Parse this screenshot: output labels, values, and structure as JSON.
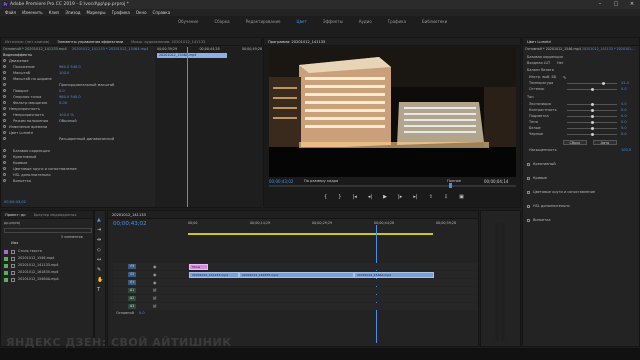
{
  "app": {
    "title": "Adobe Premiere Pro CC 2019 - E:\\vocd\\pp\\pp.prproj *",
    "icon": "Pr"
  },
  "menu": [
    "Файл",
    "Изменить",
    "Клип",
    "Эпизод",
    "Маркеры",
    "Графика",
    "Окно",
    "Справка"
  ],
  "workspaces": [
    {
      "label": "Обучение",
      "active": false
    },
    {
      "label": "Сборка",
      "active": false
    },
    {
      "label": "Редактирование",
      "active": false
    },
    {
      "label": "Цвет",
      "active": true
    },
    {
      "label": "Эффекты",
      "active": false
    },
    {
      "label": "Аудио",
      "active": false
    },
    {
      "label": "Графика",
      "active": false
    },
    {
      "label": "Библиотеки",
      "active": false
    }
  ],
  "source_panel": {
    "tabs": [
      "Источник: (нет клипов)",
      "Элементы управления эффектами",
      "Микш. аудиоклипов: 20201012_141133"
    ],
    "header": "Основной * 20201012_141133.mp4",
    "header2": "20201012_141133 * 20201012_15464.mp4",
    "video_effects_label": "Видеоэффекты",
    "rows": [
      {
        "label": "Движение",
        "value": ""
      },
      {
        "label": "Положение",
        "value": "960.0   540.0"
      },
      {
        "label": "Масштаб",
        "value": "100.0"
      },
      {
        "label": "Масштаб по ширине",
        "value": ""
      },
      {
        "label": "",
        "value": "Пропорциональный масштаб"
      },
      {
        "label": "Поворот",
        "value": "0.0"
      },
      {
        "label": "Опорная точка",
        "value": "960.0   540.0"
      },
      {
        "label": "Фильтр мерцания",
        "value": "0.00"
      },
      {
        "label": "Непрозрачность",
        "value": ""
      },
      {
        "label": "Непрозрачность",
        "value": "100.0 %"
      },
      {
        "label": "Режим наложения",
        "value": "Обычный"
      },
      {
        "label": "Изменение времени",
        "value": ""
      },
      {
        "label": "Цвет Lumetri",
        "value": ""
      },
      {
        "label": "",
        "value": "Расширенный динамический"
      },
      {
        "label": "Базовая коррекция",
        "value": ""
      },
      {
        "label": "Креативный",
        "value": ""
      },
      {
        "label": "Кривые",
        "value": ""
      },
      {
        "label": "Цветовые круги и сопоставление",
        "value": ""
      },
      {
        "label": "HSL дополнительно",
        "value": ""
      },
      {
        "label": "Виньетка",
        "value": ""
      }
    ],
    "mini_tl": {
      "times": [
        "00;00;39;29",
        "00;00;44;28",
        "00;00;49;28"
      ],
      "clip": "20201012_1546A.mp4",
      "timecode": "00;00;43;02"
    }
  },
  "program": {
    "title": "Программа: 20201012_141133",
    "timecode_left": "00;00;43;02",
    "fit": "По размеру кадра",
    "quality": "Полное",
    "timecode_right": "00;00;04;14"
  },
  "lumetri": {
    "tabs": [
      "Цвет Lumetri"
    ],
    "header": "Основной * 20201012_1546.mp4",
    "header2": "20201012_141133 * 2020101...",
    "sections": [
      {
        "label": "Базовая коррекция"
      },
      {
        "label": "Входная LUT",
        "value": "Нет"
      },
      {
        "label": "Баланс белого"
      }
    ],
    "wb_rows": [
      {
        "label": "Инстр. выб. ББ",
        "value": ""
      },
      {
        "label": "Температура",
        "value": "41.4",
        "pct": 0.72
      },
      {
        "label": "Оттенок",
        "value": "0.0",
        "pct": 0.5
      }
    ],
    "tone_label": "Тон",
    "tone_rows": [
      {
        "label": "Экспозиция",
        "value": "0.0",
        "pct": 0.5
      },
      {
        "label": "Контрастность",
        "value": "0.0",
        "pct": 0.5
      },
      {
        "label": "Подсветка",
        "value": "0.0",
        "pct": 0.5
      },
      {
        "label": "Тени",
        "value": "0.0",
        "pct": 0.5
      },
      {
        "label": "Белые",
        "value": "0.0",
        "pct": 0.5
      },
      {
        "label": "Черные",
        "value": "0.0",
        "pct": 0.5
      }
    ],
    "reset_label": "Сброс",
    "auto_label": "Авто",
    "saturation_label": "Насыщенность",
    "saturation_value": "100.0",
    "collapsed": [
      "Креативный",
      "Кривые",
      "Цветовые круги и сопоставление",
      "HSL дополнительно",
      "Виньетка"
    ]
  },
  "project": {
    "tabs": [
      "Проект: pp",
      "Браузер медиаданных"
    ],
    "file": "pp.prproj",
    "items_count": "5 элементов",
    "name_col": "Имя",
    "items": [
      {
        "name": "Стиль текста",
        "color": "#a070d0"
      },
      {
        "name": "20201012_1546.mp4",
        "color": "#55b35e"
      },
      {
        "name": "20201012_141133.mp4",
        "color": "#55b35e"
      },
      {
        "name": "20201012_161835.mp4",
        "color": "#55b35e"
      },
      {
        "name": "20201012_15464A.mp4",
        "color": "#55b35e"
      }
    ]
  },
  "timeline": {
    "tab": "20201012_141133",
    "timecode": "00;00;43;02",
    "ruler": [
      "00;00",
      "00;00;14;29",
      "00;00;29;29",
      "00;00;44;28",
      "00;00;59;28"
    ],
    "tracks": [
      "V3",
      "V2",
      "V1",
      "A1",
      "A2",
      "A3"
    ],
    "main_label": "Основной",
    "main_value": "0.0",
    "title_clip": "Shnis",
    "clips": [
      {
        "label": "20201012_141133.mp4"
      },
      {
        "label": "20201012_161835.mp4"
      },
      {
        "label": "20201012_1546A.mp4"
      }
    ]
  },
  "watermark": "ЯНДЕКС ДЗЕН: СВОЙ АЙТИШНИК"
}
